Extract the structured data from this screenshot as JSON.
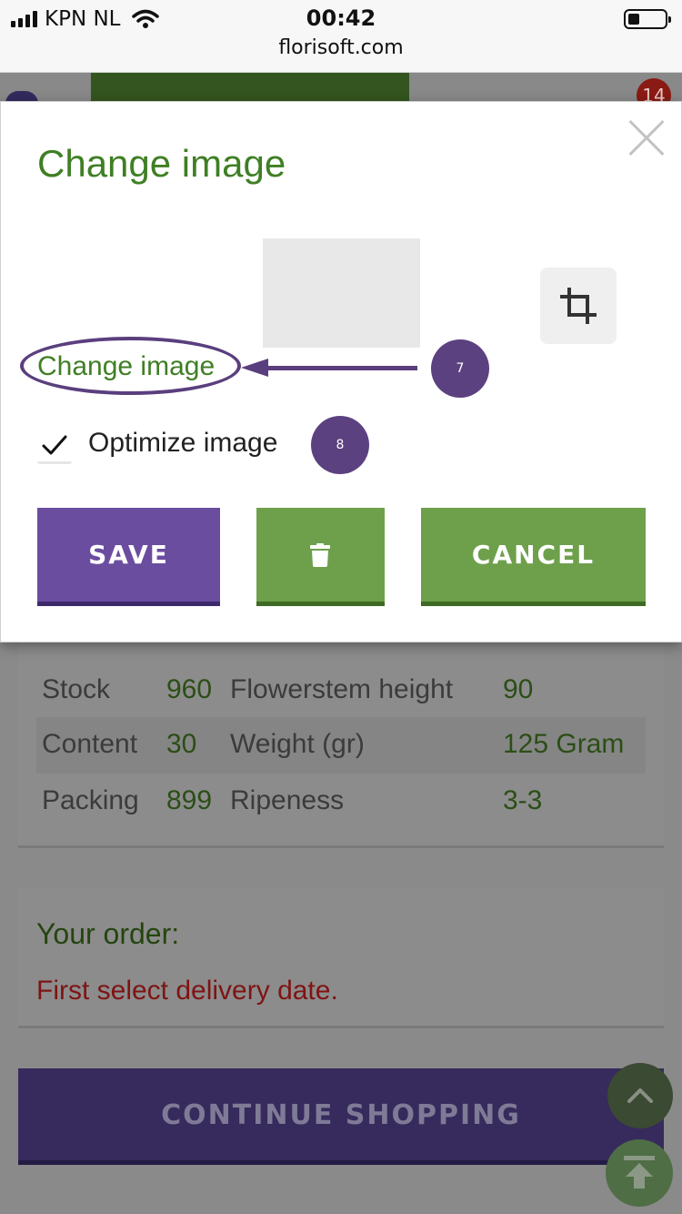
{
  "status_bar": {
    "carrier": "KPN NL",
    "time": "00:42",
    "url": "florisoft.com"
  },
  "header": {
    "cart_badge": "14"
  },
  "product_details": {
    "rows": [
      {
        "label1": "Stock",
        "value1": "960",
        "label2": "Flowerstem height",
        "value2": "90"
      },
      {
        "label1": "Content",
        "value1": "30",
        "label2": "Weight (gr)",
        "value2": "125 Gram"
      },
      {
        "label1": "Packing",
        "value1": "899",
        "label2": "Ripeness",
        "value2": "3-3"
      }
    ]
  },
  "order": {
    "title": "Your order:",
    "message": "First select delivery date."
  },
  "continue_button": "CONTINUE SHOPPING",
  "modal": {
    "title": "Change image",
    "change_image_link": "Change image",
    "optimize_label": "Optimize image",
    "optimize_checked": true,
    "save_label": "SAVE",
    "cancel_label": "CANCEL",
    "annotations": [
      "7",
      "8"
    ]
  },
  "colors": {
    "brand_green": "#6ea04c",
    "title_green": "#3f7f24",
    "brand_purple": "#6a4d9f",
    "error_red": "#b01f1c"
  },
  "icons": [
    "signal-icon",
    "wifi-icon",
    "battery-icon",
    "close-icon",
    "crop-icon",
    "check-icon",
    "trash-icon",
    "chevron-up-icon",
    "scroll-top-icon"
  ]
}
